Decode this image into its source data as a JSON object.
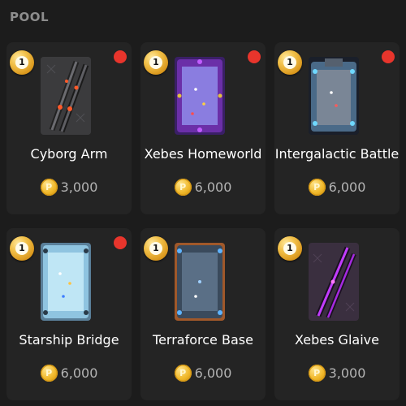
{
  "section": {
    "title": "POOL"
  },
  "items": [
    {
      "name": "Cyborg Arm",
      "price": "3,000",
      "badge": "1",
      "new": true,
      "thumb": "cyborg-arm-cue-icon"
    },
    {
      "name": "Xebes Homeworld",
      "price": "6,000",
      "badge": "1",
      "new": true,
      "thumb": "xebes-homeworld-table-icon"
    },
    {
      "name": "Intergalactic Battle",
      "price": "6,000",
      "badge": "1",
      "new": true,
      "thumb": "intergalactic-battle-table-icon"
    },
    {
      "name": "Starship Bridge",
      "price": "6,000",
      "badge": "1",
      "new": true,
      "thumb": "starship-bridge-table-icon"
    },
    {
      "name": "Terraforce Base",
      "price": "6,000",
      "badge": "1",
      "new": false,
      "thumb": "terraforce-base-table-icon"
    },
    {
      "name": "Xebes Glaive",
      "price": "3,000",
      "badge": "1",
      "new": false,
      "thumb": "xebes-glaive-cue-icon"
    }
  ],
  "coin_symbol": "P",
  "colors": {
    "background": "#1c1c1c",
    "card": "#242424",
    "new_dot": "#e8352c",
    "coin": "#f0b82a",
    "price_text": "#b4b4b4"
  }
}
